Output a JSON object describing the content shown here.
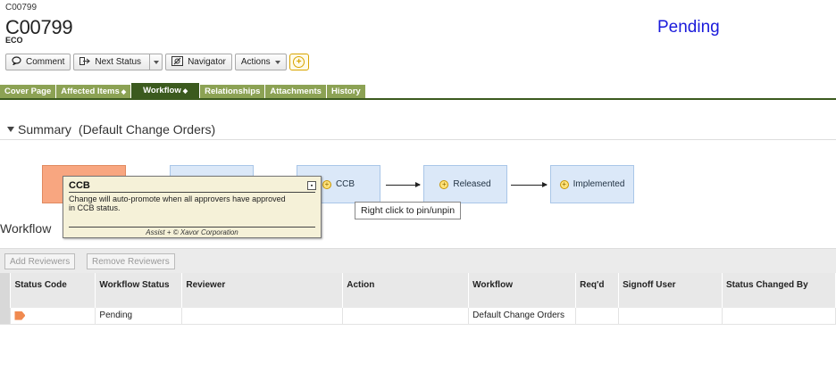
{
  "header": {
    "breadcrumb": "C00799",
    "object_number": "C00799",
    "object_type": "ECO",
    "status": "Pending"
  },
  "toolbar": {
    "comment_label": "Comment",
    "next_status_label": "Next Status",
    "navigator_label": "Navigator",
    "actions_label": "Actions"
  },
  "tabs": [
    {
      "label": "Cover Page",
      "marker": ""
    },
    {
      "label": "Affected Items",
      "marker": "◆"
    },
    {
      "label": "Workflow",
      "marker": "◆"
    },
    {
      "label": "Relationships",
      "marker": ""
    },
    {
      "label": "Attachments",
      "marker": ""
    },
    {
      "label": "History",
      "marker": ""
    }
  ],
  "summary": {
    "title": "Summary",
    "subtitle": "(Default Change Orders)"
  },
  "workflow_nodes": [
    {
      "label": "",
      "icon": ""
    },
    {
      "label": "",
      "icon": ""
    },
    {
      "label": "CCB",
      "icon": "status-icon"
    },
    {
      "label": "Released",
      "icon": "status-icon"
    },
    {
      "label": "Implemented",
      "icon": "status-icon"
    }
  ],
  "tooltip": {
    "title": "CCB",
    "body": "Change will auto-promote when all approvers have approved in CCB status.",
    "footer": "Assist + © Xavor Corporation"
  },
  "pin_hint": "Right click to pin/unpin",
  "workflow_section_label": "Workflow",
  "grid": {
    "add_reviewers_label": "Add Reviewers",
    "remove_reviewers_label": "Remove Reviewers",
    "columns": [
      "Status Code",
      "Workflow Status",
      "Reviewer",
      "Action",
      "Workflow",
      "Req'd",
      "Signoff User",
      "Status Changed By"
    ],
    "rows": [
      {
        "status_code": "",
        "workflow_status": "Pending",
        "reviewer": "",
        "action": "",
        "workflow": "Default Change Orders",
        "reqd": "",
        "signoff_user": "",
        "status_changed_by": ""
      }
    ]
  },
  "colors": {
    "status_text": "#1a1adb",
    "tab_bg": "#8ca254",
    "tab_active_bg": "#3b5a1e",
    "current_node": "#f8a680",
    "node_bg": "#dbe8f8",
    "tooltip_bg": "#f5f1d8"
  }
}
